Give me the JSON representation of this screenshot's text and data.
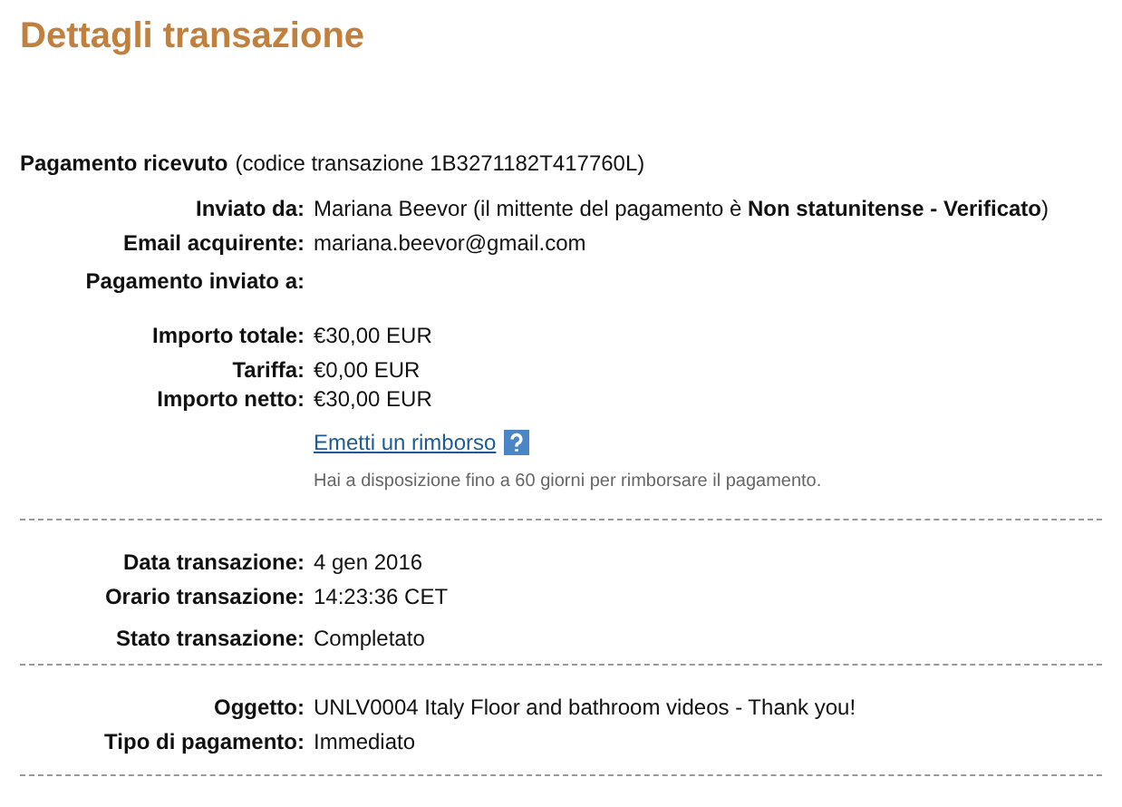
{
  "title": "Dettagli transazione",
  "header": {
    "label": "Pagamento ricevuto",
    "detail": "(codice transazione 1B3271182T417760L)"
  },
  "sections": [
    {
      "rows": [
        {
          "label": "Inviato da:",
          "value": "Mariana Beevor (il mittente del pagamento è **Non statunitense - Verificato**)"
        },
        {
          "label": "Email acquirente:",
          "value": "mariana.beevor@gmail.com"
        },
        {
          "label": "Pagamento inviato a:"
        },
        {
          "label": "Importo totale:",
          "value": "€30,00 EUR"
        },
        {
          "label": "Tariffa:",
          "value": "€0,00 EUR"
        },
        {
          "label": "Importo netto:",
          "value": "€30,00 EUR"
        }
      ],
      "link": "Emetti un rimborso",
      "note": "Hai a disposizione fino a 60 giorni per rimborsare il pagamento."
    },
    {
      "rows": [
        {
          "label": "Data transazione:",
          "value": "4 gen 2016"
        },
        {
          "label": "Orario transazione:",
          "value": "14:23:36 CET"
        },
        {
          "label": "Stato transazione:",
          "value": "Completato"
        }
      ]
    },
    {
      "rows": [
        {
          "label": "Oggetto:",
          "value": "UNLV0004 Italy Floor and bathroom videos - Thank you!"
        },
        {
          "label": "Tipo di pagamento:",
          "value": "Immediato"
        }
      ]
    }
  ]
}
